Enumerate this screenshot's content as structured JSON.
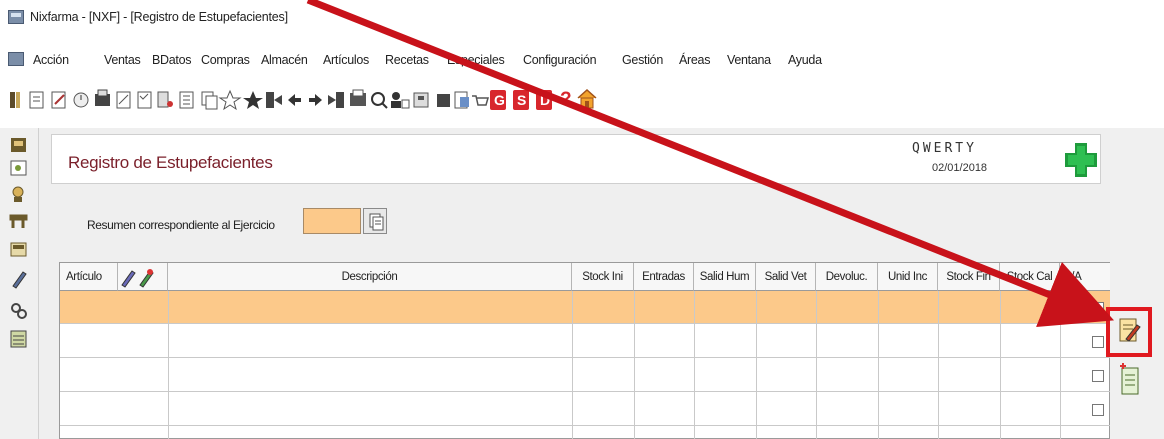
{
  "window": {
    "title": "Nixfarma - [NXF] - [Registro de Estupefacientes]"
  },
  "menu": {
    "items": [
      "Acción",
      "Ventas",
      "BDatos",
      "Compras",
      "Almacén",
      "Artículos",
      "Recetas",
      "Especiales",
      "Configuración",
      "Gestión",
      "Áreas",
      "Ventana",
      "Ayuda"
    ]
  },
  "toolbar": {
    "letters": [
      "G",
      "S",
      "D"
    ],
    "help": "?"
  },
  "page": {
    "title": "Registro de Estupefacientes",
    "user": "QWERTY",
    "date": "02/01/2018"
  },
  "filter": {
    "label": "Resumen correspondiente al Ejercicio",
    "value": ""
  },
  "table": {
    "columns": [
      "Artículo",
      "Descripción",
      "Stock Ini",
      "Entradas",
      "Salid Hum",
      "Salid Vet",
      "Devoluc.",
      "Unid Inc",
      "Stock Fin",
      "Stock Cal",
      "S/A"
    ],
    "rows": 4
  },
  "colors": {
    "accent_row": "#fcc98a",
    "title_color": "#7a1f2a",
    "highlight": "#e0191f",
    "arrow": "#c8121a",
    "cross": "#1e9b3c"
  }
}
